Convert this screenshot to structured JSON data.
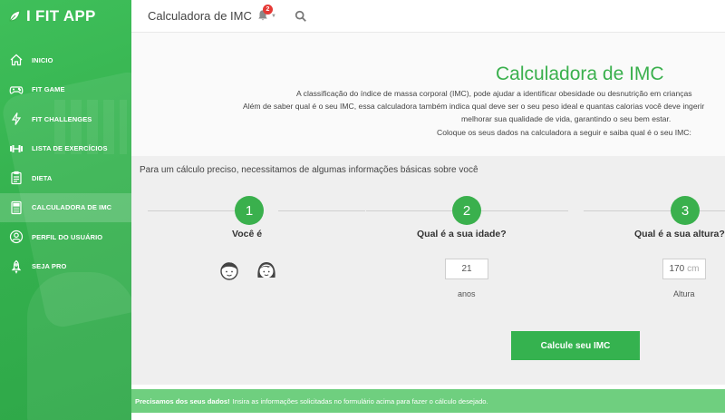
{
  "app": {
    "name": "I FIT APP"
  },
  "sidebar": {
    "items": [
      {
        "label": "INICIO",
        "icon": "home-icon"
      },
      {
        "label": "FIT GAME",
        "icon": "gamepad-icon"
      },
      {
        "label": "FIT CHALLENGES",
        "icon": "lightning-icon"
      },
      {
        "label": "LISTA DE EXERCÍCIOS",
        "icon": "dumbbell-icon"
      },
      {
        "label": "DIETA",
        "icon": "clipboard-icon"
      },
      {
        "label": "CALCULADORA DE IMC",
        "icon": "calculator-icon",
        "active": true
      },
      {
        "label": "PERFIL DO USUÁRIO",
        "icon": "user-circle-icon"
      },
      {
        "label": "SEJA PRO",
        "icon": "rocket-icon"
      }
    ]
  },
  "topbar": {
    "title": "Calculadora de IMC",
    "notification_count": "2"
  },
  "intro": {
    "title": "Calculadora de IMC",
    "line1": "A classificação do índice de massa corporal (IMC), pode ajudar a identificar obesidade ou desnutrição em crianças",
    "line2": "Além de saber qual é o seu IMC, essa calculadora também indica qual deve ser o seu peso ideal e quantas calorias você deve ingerir",
    "line3": "melhorar sua qualidade de vida, garantindo o seu bem estar.",
    "line4": "Coloque os seus dados na calculadora a seguir e saiba qual é o seu IMC:"
  },
  "form": {
    "lead": "Para um cálculo preciso, necessitamos de algumas informações básicas sobre você",
    "steps": [
      {
        "number": "1",
        "label": "Você é"
      },
      {
        "number": "2",
        "label": "Qual é a sua idade?",
        "value": "21",
        "caption": "anos"
      },
      {
        "number": "3",
        "label": "Qual é a sua altura?",
        "value": "170",
        "unit": "cm",
        "caption": "Altura"
      }
    ],
    "submit_label": "Calcule seu IMC"
  },
  "alert": {
    "strong": "Precisamos dos seus dados!",
    "text": "Insira as informações solicitadas no formulário acima para fazer o cálculo desejado."
  },
  "colors": {
    "brand_green": "#3ab04d",
    "alert_green": "#6fcf7f",
    "badge_red": "#e53935"
  }
}
